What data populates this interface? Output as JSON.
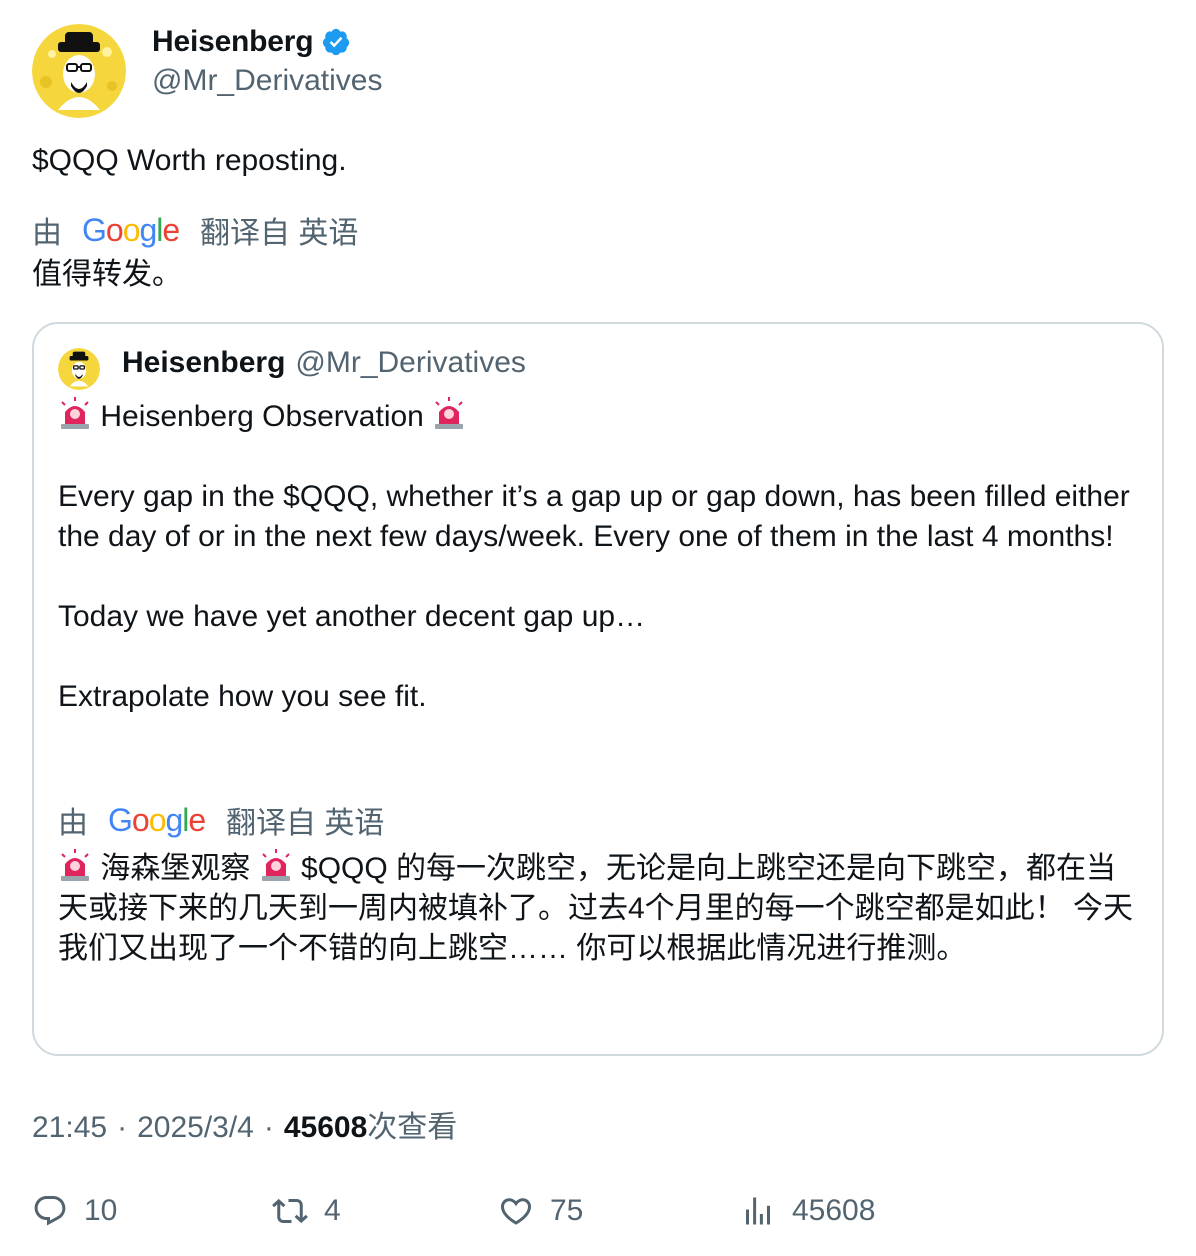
{
  "author": {
    "display_name": "Heisenberg",
    "handle": "@Mr_Derivatives",
    "verified_icon": "verified-badge-icon"
  },
  "tweet": {
    "text": "$QQQ Worth reposting.",
    "translation": {
      "prefix": "由",
      "provider": "Google",
      "suffix": "翻译自 英语",
      "text": "值得转发。"
    }
  },
  "quoted_tweet": {
    "display_name": "Heisenberg",
    "handle": "@Mr_Derivatives",
    "line_title": "Heisenberg Observation",
    "paragraph_1": "Every gap in the $QQQ, whether it’s a gap up or gap down, has been filled either the day of or in the next few days/week. Every one of them in the last 4 months!",
    "paragraph_2": "Today we have yet another decent gap up…",
    "paragraph_3": "Extrapolate how you see fit.",
    "translation": {
      "prefix": "由",
      "provider": "Google",
      "suffix": "翻译自 英语",
      "text_1": "海森堡观察",
      "text_2": "$QQQ 的每一次跳空，无论是向上跳空还是向下跳空，都在当天或接下来的几天到一周内被填补了。过去4个月里的每一个跳空都是如此！ 今天我们又出现了一个不错的向上跳空…… 你可以根据此情况进行推测。"
    }
  },
  "meta": {
    "time": "21:45",
    "separator": "·",
    "date": "2025/3/4",
    "views_count": "45608",
    "views_label": "次查看"
  },
  "actions": {
    "replies": "10",
    "reposts": "4",
    "likes": "75",
    "views": "45608"
  },
  "colors": {
    "text_primary": "#0f1419",
    "text_secondary": "#536471",
    "border": "#cfd9de",
    "verified": "#1d9bf0"
  }
}
